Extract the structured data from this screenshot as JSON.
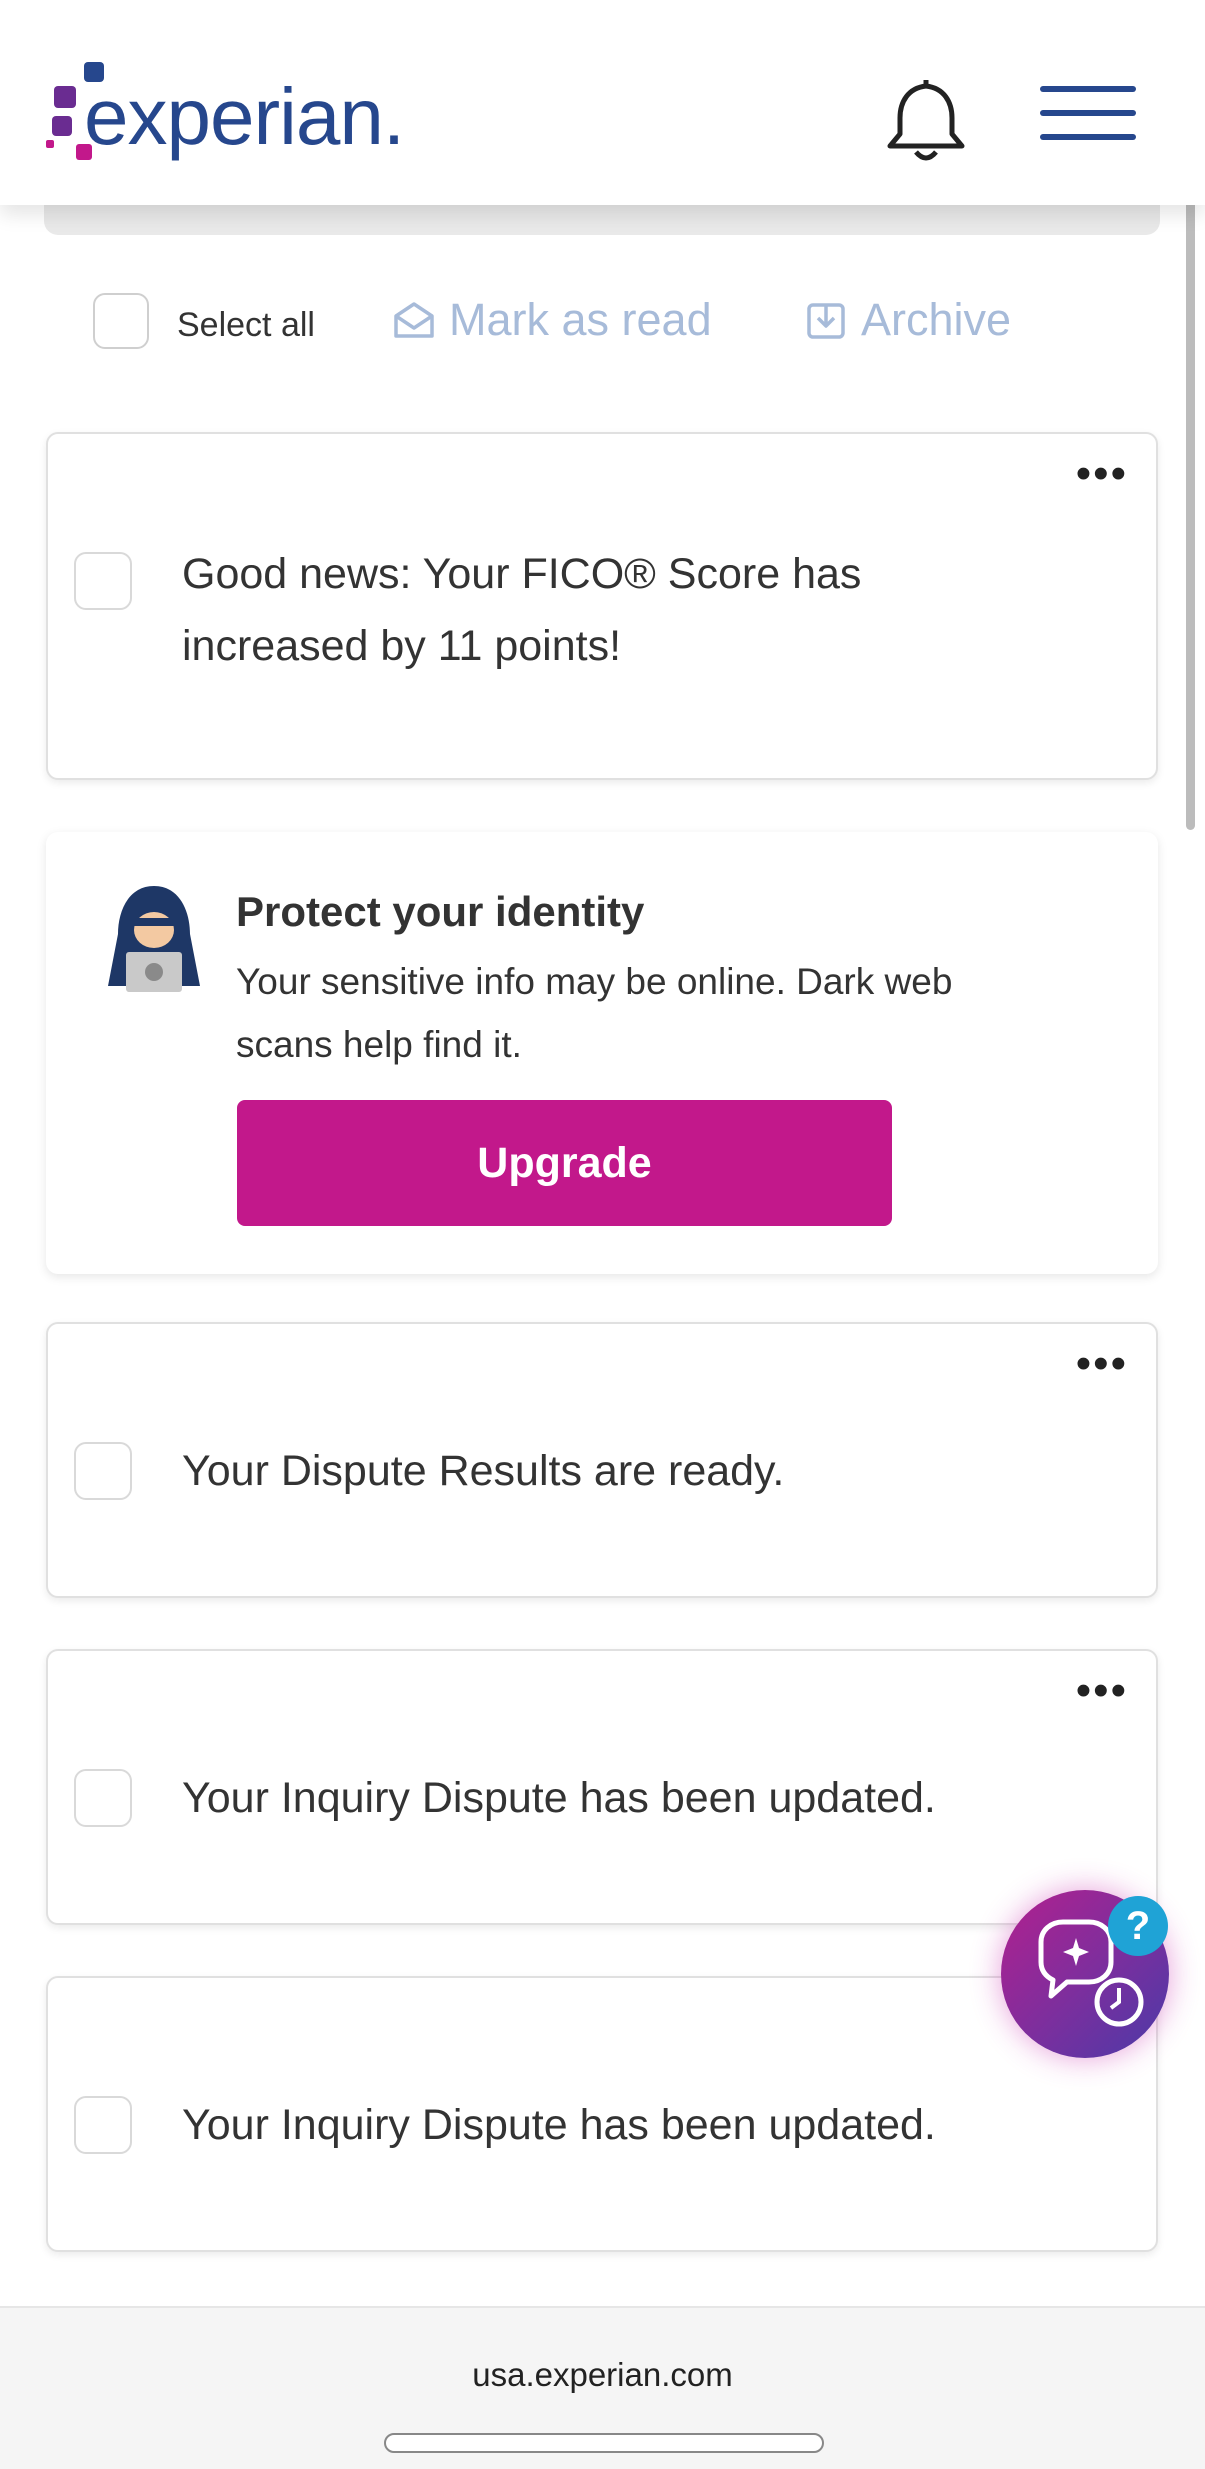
{
  "header": {
    "logo_text": "experian.",
    "brand_colors": {
      "primary": "#26478d",
      "accent_magenta": "#c2188b",
      "accent_purple": "#6a2c91"
    }
  },
  "toolbar": {
    "select_all_label": "Select all",
    "mark_as_read_label": "Mark as read",
    "archive_label": "Archive"
  },
  "notifications": [
    {
      "text_line1": "Good news: Your FICO® Score has",
      "text_line2": "increased by 11 points!"
    },
    {
      "text": "Your Dispute Results are ready."
    },
    {
      "text": "Your Inquiry Dispute has been updated."
    },
    {
      "text": "Your Inquiry Dispute has been updated."
    }
  ],
  "promo": {
    "title": "Protect your identity",
    "body_line1": "Your sensitive info may be online. Dark web",
    "body_line2": "scans help find it.",
    "button_label": "Upgrade"
  },
  "chat": {
    "help_badge": "?"
  },
  "browser": {
    "url": "usa.experian.com"
  }
}
